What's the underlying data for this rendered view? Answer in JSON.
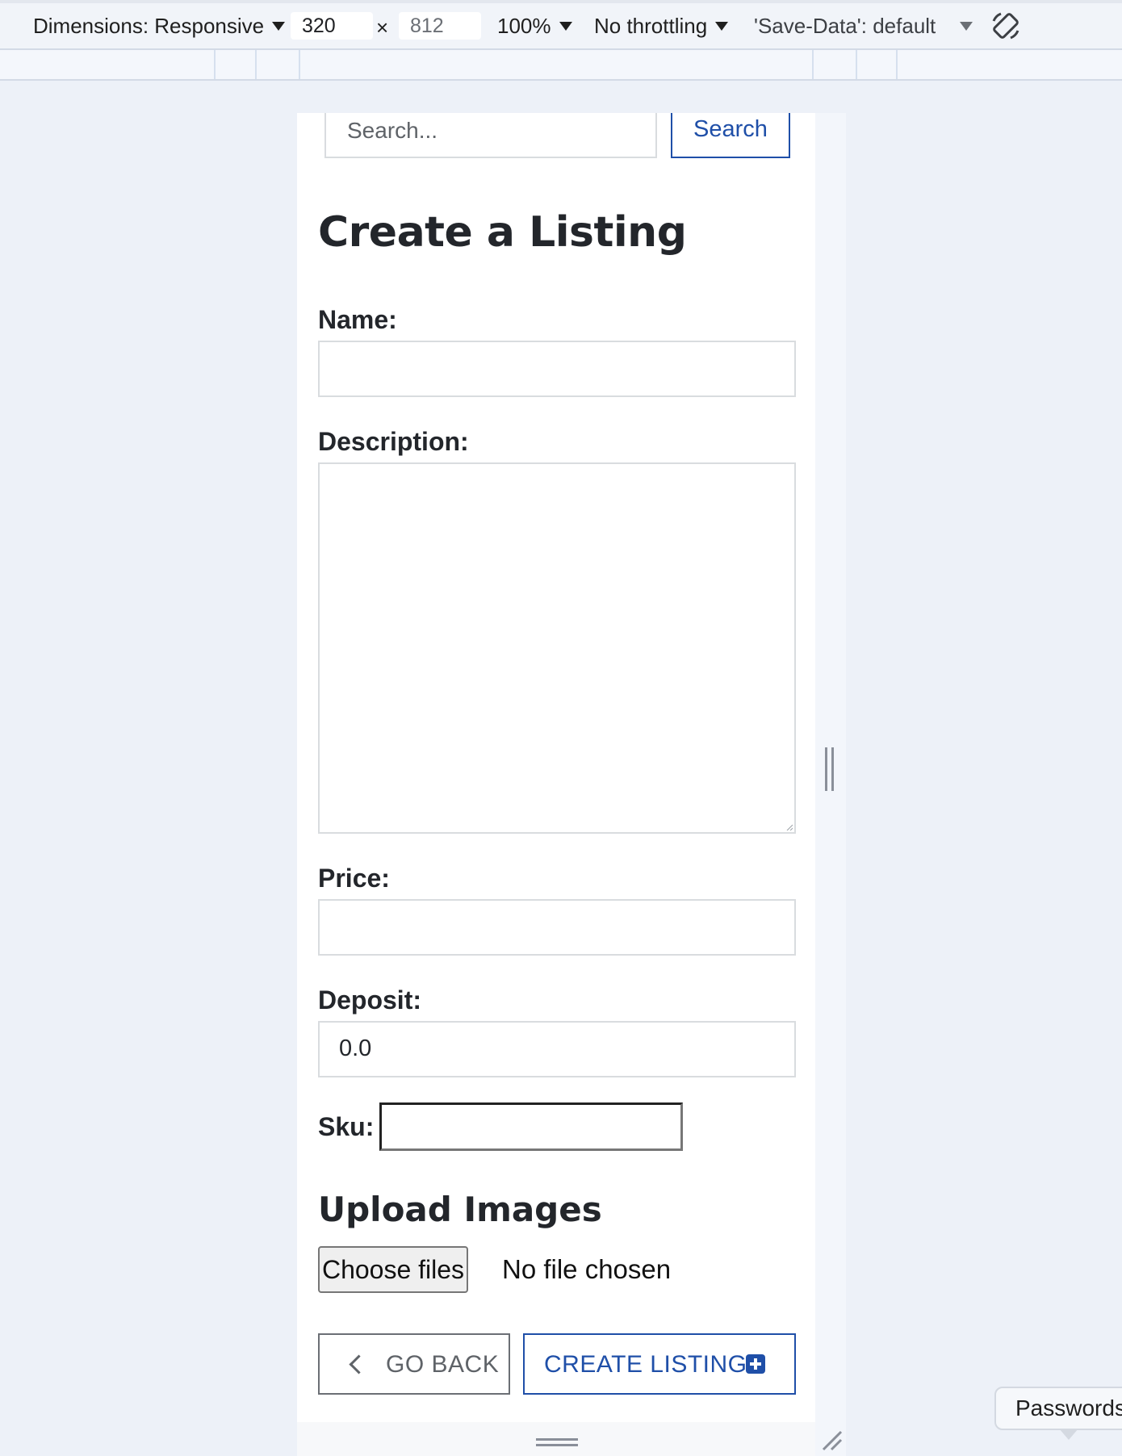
{
  "devtools": {
    "dimensions_label": "Dimensions: Responsive",
    "width_value": "320",
    "times_sign": "×",
    "height_value": "812",
    "zoom": "100%",
    "throttling": "No throttling",
    "save_data": "'Save-Data': default"
  },
  "search": {
    "placeholder": "Search...",
    "button_label": "Search"
  },
  "page": {
    "title": "Create a Listing"
  },
  "form": {
    "name_label": "Name:",
    "name_value": "",
    "description_label": "Description:",
    "description_value": "",
    "price_label": "Price:",
    "price_value": "",
    "deposit_label": "Deposit:",
    "deposit_value": "0.0",
    "sku_label": "Sku:",
    "sku_value": ""
  },
  "upload": {
    "title": "Upload Images",
    "choose_label": "Choose files",
    "status": "No file chosen"
  },
  "actions": {
    "go_back_label": "GO BACK",
    "create_label": "CREATE LISTING"
  },
  "tooltip": {
    "passwords": "Passwords"
  },
  "colors": {
    "accent": "#1f4fa8",
    "page_background": "#edf1f8"
  }
}
